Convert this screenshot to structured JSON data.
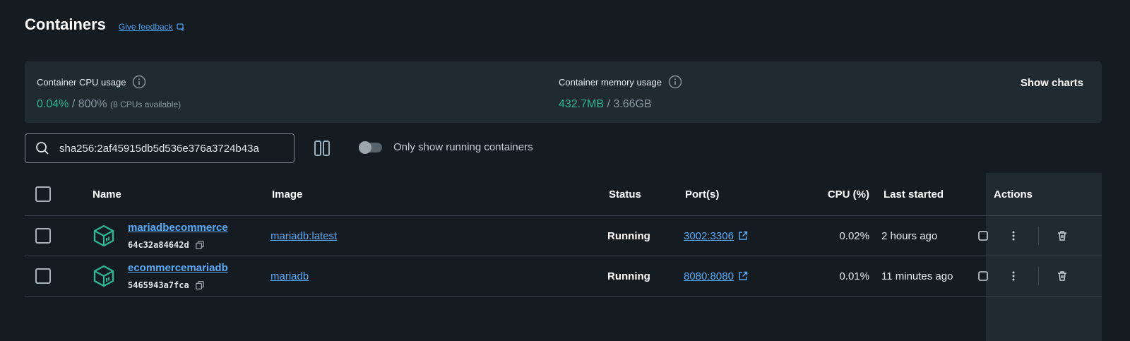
{
  "header": {
    "title": "Containers",
    "feedback_label": "Give feedback"
  },
  "stats": {
    "cpu": {
      "label": "Container CPU usage",
      "used": "0.04%",
      "sep": " / ",
      "total": "800%",
      "note": "(8 CPUs available)"
    },
    "memory": {
      "label": "Container memory usage",
      "used": "432.7MB",
      "sep": " / ",
      "total": "3.66GB"
    },
    "show_charts_label": "Show charts"
  },
  "search": {
    "value": "sha256:2af45915db5d536e376a3724b43a"
  },
  "filter": {
    "only_running_label": "Only show running containers",
    "only_running": false
  },
  "table": {
    "headers": {
      "name": "Name",
      "image": "Image",
      "status": "Status",
      "ports": "Port(s)",
      "cpu": "CPU (%)",
      "last_started": "Last started",
      "actions": "Actions"
    },
    "rows": [
      {
        "name": "mariadbecommerce",
        "id": "64c32a84642d",
        "image": "mariadb:latest",
        "status": "Running",
        "port": "3002:3306",
        "cpu": "0.02%",
        "last_started": "2 hours ago"
      },
      {
        "name": "ecommercemariadb",
        "id": "5465943a7fca",
        "image": "mariadb",
        "status": "Running",
        "port": "8080:8080",
        "cpu": "0.01%",
        "last_started": "11 minutes ago"
      }
    ]
  },
  "colors": {
    "background": "#141c21",
    "panel": "#1f2a31",
    "accent_green": "#2fb592",
    "link_blue": "#5aa9f5",
    "container_icon": "#2fb592"
  },
  "icons": {
    "feedback": "feedback-icon",
    "info": "info-icon",
    "search": "search-icon",
    "columns": "columns-icon",
    "container": "container-icon",
    "copy": "copy-icon",
    "external_link": "external-link-icon",
    "stop": "stop-icon",
    "more": "more-vertical-icon",
    "delete": "trash-icon"
  }
}
